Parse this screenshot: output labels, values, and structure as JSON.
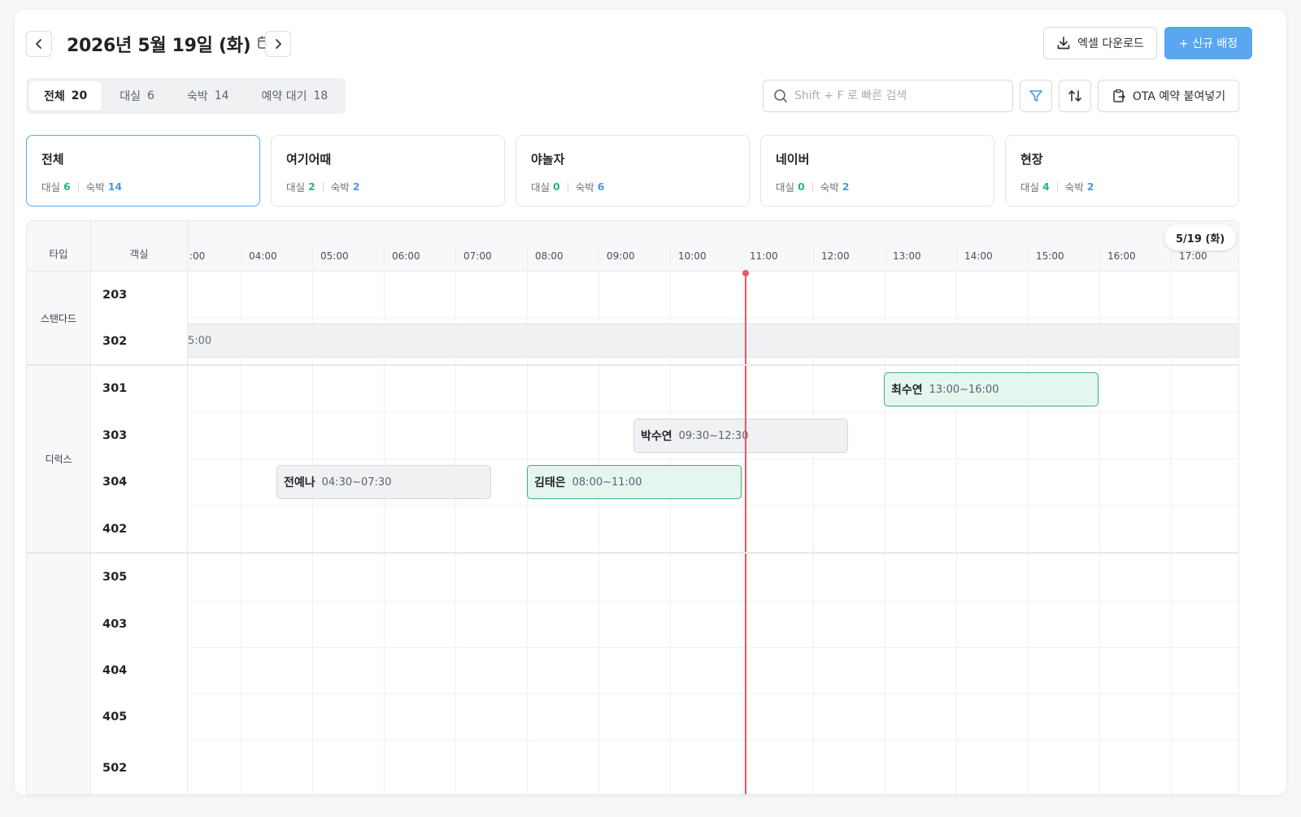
{
  "header": {
    "date_title": "2026년 5월 19일 (화)",
    "excel_download_label": "엑셀 다운로드",
    "new_assign_label": "+ 신규 배정"
  },
  "tabs": [
    {
      "label": "전체",
      "count": "20"
    },
    {
      "label": "대실",
      "count": "6"
    },
    {
      "label": "숙박",
      "count": "14"
    },
    {
      "label": "예약 대기",
      "count": "18"
    }
  ],
  "search": {
    "placeholder": "Shift + F 로 빠른 검색"
  },
  "toolbar": {
    "ota_paste_label": "OTA 예약 붙여넣기"
  },
  "channels": [
    {
      "name": "전체",
      "daesil_label": "대실",
      "daesil": "6",
      "sukbak_label": "숙박",
      "sukbak": "14"
    },
    {
      "name": "여기어때",
      "daesil_label": "대실",
      "daesil": "2",
      "sukbak_label": "숙박",
      "sukbak": "2"
    },
    {
      "name": "야놀자",
      "daesil_label": "대실",
      "daesil": "0",
      "sukbak_label": "숙박",
      "sukbak": "6"
    },
    {
      "name": "네이버",
      "daesil_label": "대실",
      "daesil": "0",
      "sukbak_label": "숙박",
      "sukbak": "2"
    },
    {
      "name": "현장",
      "daesil_label": "대실",
      "daesil": "4",
      "sukbak_label": "숙박",
      "sukbak": "2"
    }
  ],
  "grid": {
    "type_header": "타입",
    "room_header": "객실",
    "date_chip": "5/19 (화)",
    "times": [
      ":00",
      "04:00",
      "05:00",
      "06:00",
      "07:00",
      "08:00",
      "09:00",
      "10:00",
      "11:00",
      "12:00",
      "13:00",
      "14:00",
      "15:00",
      "16:00",
      "17:00"
    ],
    "types": [
      "스탠다드",
      "디럭스",
      ""
    ],
    "rooms": [
      "203",
      "302",
      "301",
      "303",
      "304",
      "402",
      "305",
      "403",
      "404",
      "405",
      "502"
    ],
    "blocked_302_text": "5:00",
    "reservations": [
      {
        "name": "최수연",
        "time": "13:00~16:00",
        "room": "301",
        "status": "green"
      },
      {
        "name": "박수연",
        "time": "09:30~12:30",
        "room": "303",
        "status": "gray"
      },
      {
        "name": "전예나",
        "time": "04:30~07:30",
        "room": "304",
        "status": "gray"
      },
      {
        "name": "김태은",
        "time": "08:00~11:00",
        "room": "304",
        "status": "green"
      }
    ],
    "current_time": "10:48"
  },
  "colors": {
    "primary": "#5aa6f0",
    "green": "#36b07f",
    "now": "#e9585b"
  }
}
